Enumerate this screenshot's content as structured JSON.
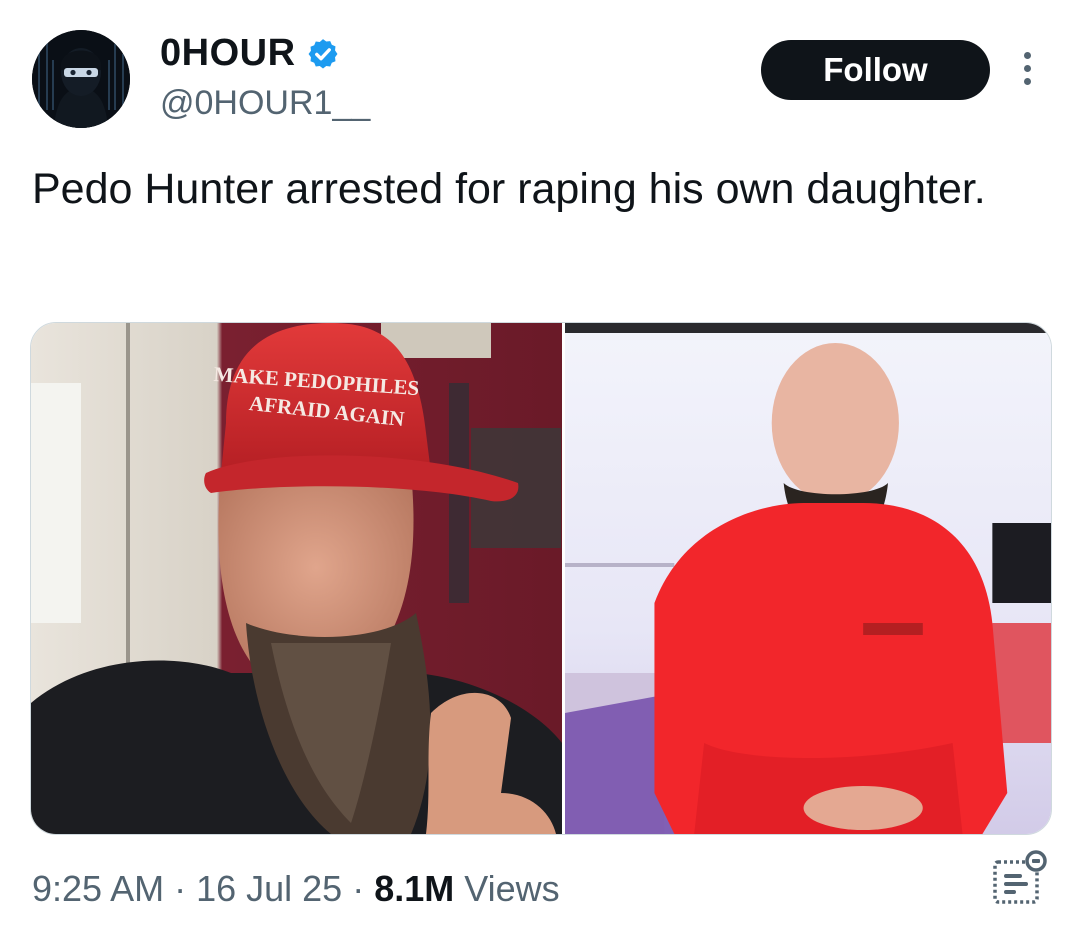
{
  "author": {
    "display_name": "0HOUR",
    "handle": "@0HOUR1__",
    "verified": true,
    "avatar_icon": "masked-hacker-avatar"
  },
  "actions": {
    "follow_label": "Follow",
    "more_icon": "more-vertical-icon"
  },
  "tweet": {
    "text": "Pedo Hunter arrested for raping his own daughter."
  },
  "media": {
    "left_photo": {
      "hat_text_line1": "MAKE PEDOPHILES",
      "hat_text_line2": "AFRAID AGAIN"
    },
    "right_photo": {}
  },
  "meta": {
    "time": "9:25 AM",
    "separator": "·",
    "date": "16 Jul 25",
    "views_count": "8.1M",
    "views_label": "Views",
    "analytics_icon": "analytics-icon"
  },
  "colors": {
    "follow_bg": "#0f1419",
    "verified_blue": "#1d9bf0",
    "secondary_text": "#536471"
  }
}
